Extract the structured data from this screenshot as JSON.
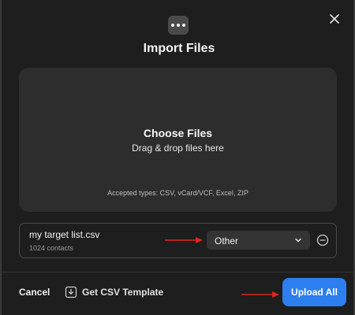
{
  "modal": {
    "title": "Import Files",
    "more_icon": "more-horizontal-icon",
    "close_icon": "close-icon"
  },
  "dropzone": {
    "title": "Choose Files",
    "subtitle": "Drag & drop files here",
    "accepted": "Accepted types: CSV, vCard/VCF, Excel, ZIP"
  },
  "file": {
    "name": "my target list.csv",
    "count": "1024 contacts",
    "type_selected": "Other",
    "remove_icon": "minus-circle-icon"
  },
  "footer": {
    "cancel_label": "Cancel",
    "template_label": "Get CSV Template",
    "template_icon": "download-icon",
    "upload_label": "Upload All"
  },
  "colors": {
    "background": "#1e1e1e",
    "panel": "#2d2d2d",
    "primary": "#2d7ff0",
    "annotation_arrow": "#e0231c"
  }
}
